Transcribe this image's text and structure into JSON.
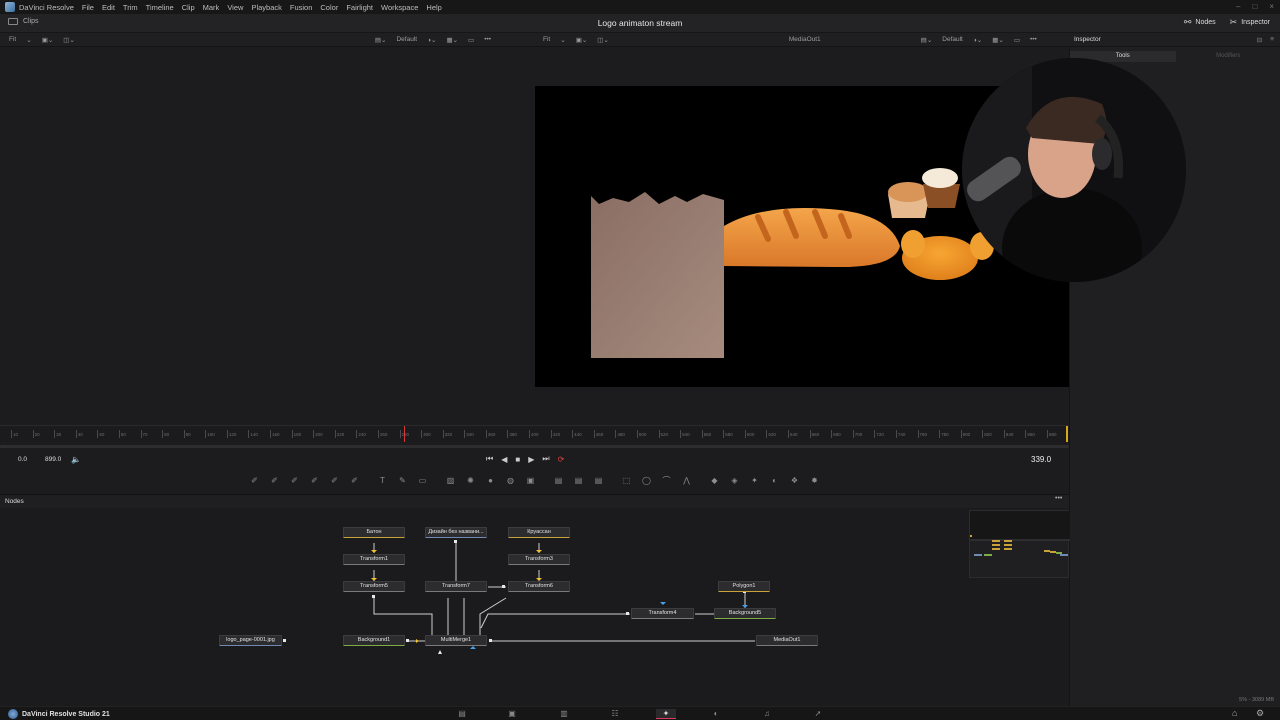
{
  "app": {
    "menu": [
      "DaVinci Resolve",
      "File",
      "Edit",
      "Trim",
      "Timeline",
      "Clip",
      "Mark",
      "View",
      "Playback",
      "Fusion",
      "Color",
      "Fairlight",
      "Workspace",
      "Help"
    ]
  },
  "titlebar": {
    "clips_label": "Clips",
    "project_title": "Logo animaton stream",
    "nodes_button": "Nodes",
    "inspector_button": "Inspector"
  },
  "viewer_left": {
    "fit_label": "Fit",
    "lut_label": "Default"
  },
  "viewer_right": {
    "fit_label": "Fit",
    "node_label": "MediaOut1",
    "lut_label": "Default"
  },
  "inspector": {
    "title": "Inspector",
    "tab_tools": "Tools",
    "tab_modifiers": "Modifiers",
    "memory": "5% - 3089 MB"
  },
  "ruler": {
    "labels": [
      "10",
      "20",
      "30",
      "40",
      "50",
      "60",
      "70",
      "80",
      "90",
      "100",
      "120",
      "140",
      "160",
      "180",
      "200",
      "220",
      "240",
      "260",
      "280",
      "300",
      "320",
      "340",
      "360",
      "380",
      "400",
      "420",
      "440",
      "460",
      "480",
      "500",
      "520",
      "540",
      "560",
      "580",
      "600",
      "620",
      "640",
      "660",
      "680",
      "700",
      "720",
      "740",
      "760",
      "780",
      "800",
      "820",
      "840",
      "860",
      "880"
    ]
  },
  "transport": {
    "start": "0.0",
    "end": "899.0",
    "current_frame": "339.0"
  },
  "nodes": {
    "panel_title": "Nodes",
    "items": {
      "baton": "Батон",
      "dizayn": "Дизайн без названи...",
      "kruassan": "Круассан",
      "transform1": "Transform1",
      "transform3": "Transform3",
      "transform5": "Transform5",
      "transform7": "Transform7",
      "transform6": "Transform6",
      "polygon1": "Polygon1",
      "transform4": "Transform4",
      "background5": "Background5",
      "logo_page": "logo_page-0001.jpg",
      "background1": "Background1",
      "multimerge1": "MultiMerge1",
      "mediaout1": "MediaOut1"
    }
  },
  "pagebar": {
    "brand": "DaVinci Resolve Studio 21"
  }
}
